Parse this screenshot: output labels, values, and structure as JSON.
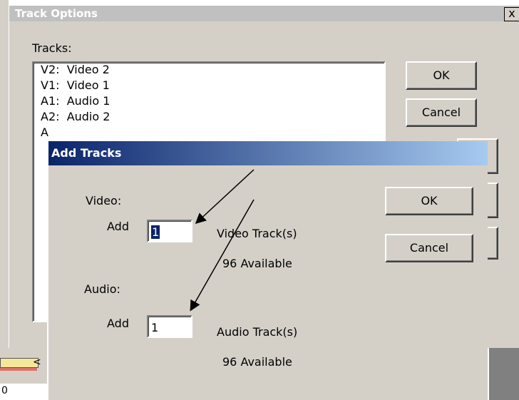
{
  "track_options": {
    "title": "Track Options",
    "close_label": "x",
    "tracks_label": "Tracks:",
    "tracks": [
      {
        "id": "V2:",
        "name": "Video 2"
      },
      {
        "id": "V1:",
        "name": "Video 1"
      },
      {
        "id": "A1:",
        "name": "Audio 1"
      },
      {
        "id": "A2:",
        "name": "Audio 2"
      },
      {
        "id": "A",
        "name": ""
      }
    ],
    "ok_label": "OK",
    "cancel_label": "Cancel"
  },
  "add_tracks": {
    "title": "Add Tracks",
    "video_label": "Video:",
    "audio_label": "Audio:",
    "video_add_label": "Add",
    "audio_add_label": "Add",
    "video_count": "1",
    "audio_count": "1",
    "video_track_label": "Video Track(s)",
    "audio_track_label": "Audio Track(s)",
    "video_available": "96  Available",
    "audio_available": "96  Available",
    "ok_label": "OK",
    "cancel_label": "Cancel"
  },
  "background": {
    "timeline_marker": "<",
    "bottom_text": "0"
  }
}
